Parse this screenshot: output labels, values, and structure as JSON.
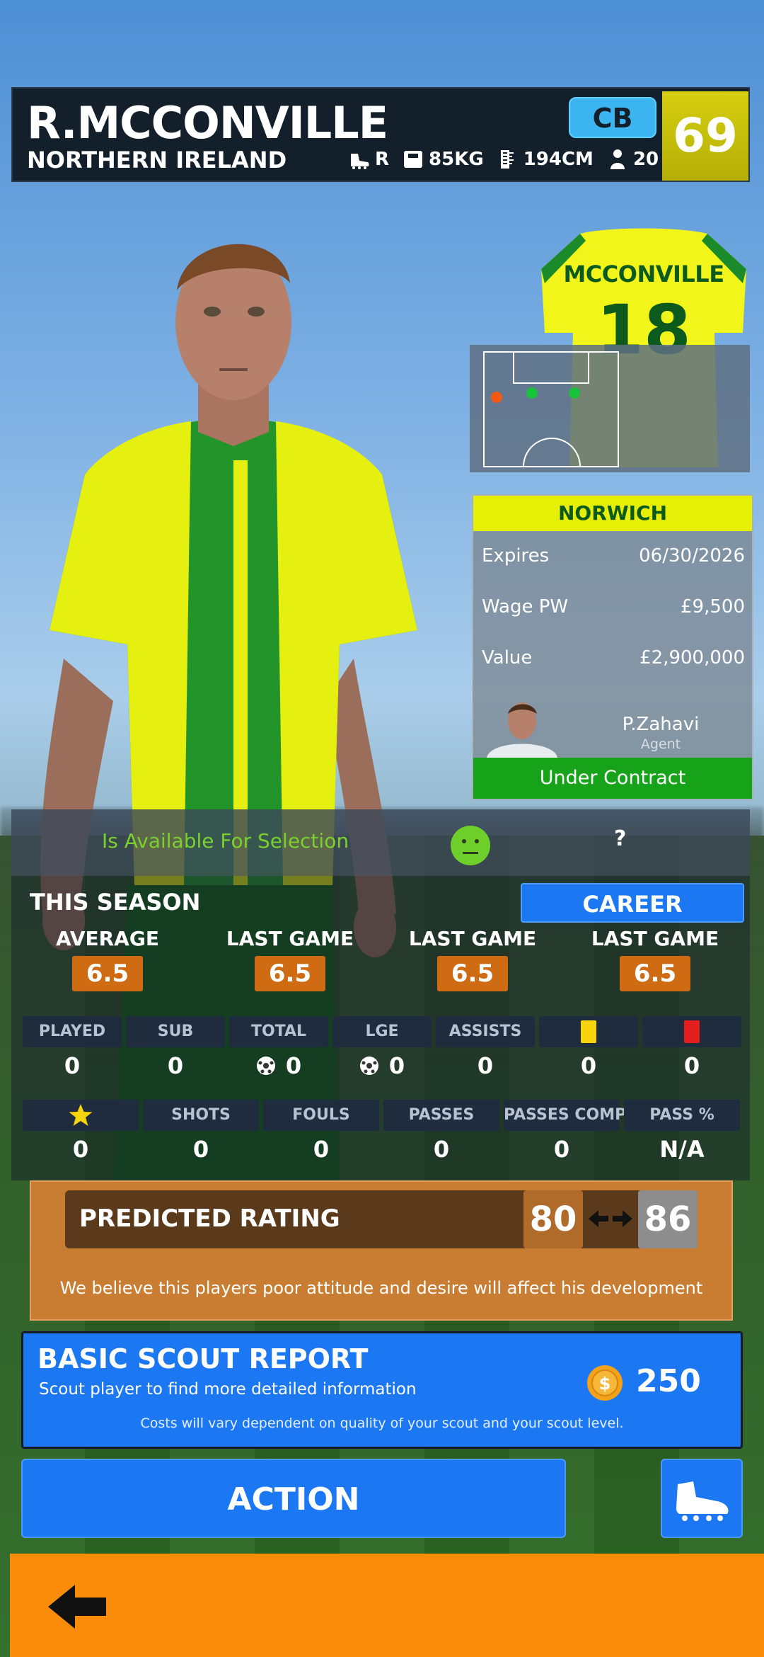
{
  "header": {
    "player_name": "R.MCCONVILLE",
    "nationality": "NORTHERN IRELAND",
    "position": "CB",
    "overall": "69",
    "foot": "R",
    "weight": "85KG",
    "height": "194CM",
    "age": "20"
  },
  "shirt": {
    "name": "MCCONVILLE",
    "number": "18"
  },
  "club": {
    "name": "NORWICH",
    "expires_label": "Expires",
    "expires_value": "06/30/2026",
    "wage_label": "Wage PW",
    "wage_value": "£9,500",
    "value_label": "Value",
    "value_value": "£2,900,000",
    "agent_name": "P.Zahavi",
    "agent_role": "Agent",
    "contract_status": "Under Contract"
  },
  "availability": {
    "text": "Is Available For Selection",
    "unknown": "?"
  },
  "season": {
    "title": "THIS SEASON",
    "career_button": "CAREER",
    "ratings": [
      {
        "label": "AVERAGE",
        "value": "6.5"
      },
      {
        "label": "LAST GAME",
        "value": "6.5"
      },
      {
        "label": "LAST GAME",
        "value": "6.5"
      },
      {
        "label": "LAST GAME",
        "value": "6.5"
      }
    ],
    "stats_row1": [
      {
        "label": "PLAYED",
        "value": "0"
      },
      {
        "label": "SUB",
        "value": "0"
      },
      {
        "label": "TOTAL",
        "value": "0"
      },
      {
        "label": "LGE",
        "value": "0"
      },
      {
        "label": "ASSISTS",
        "value": "0"
      },
      {
        "label": "",
        "value": "0"
      },
      {
        "label": "",
        "value": "0"
      }
    ],
    "stats_row2": [
      {
        "label": "",
        "value": "0"
      },
      {
        "label": "SHOTS",
        "value": "0"
      },
      {
        "label": "FOULS",
        "value": "0"
      },
      {
        "label": "PASSES",
        "value": "0"
      },
      {
        "label": "PASSES COMP",
        "value": "0"
      },
      {
        "label": "PASS %",
        "value": "N/A"
      }
    ]
  },
  "predicted": {
    "title": "PREDICTED RATING",
    "low": "80",
    "high": "86",
    "note": "We believe this players poor attitude and desire will affect his development"
  },
  "scout": {
    "title": "BASIC SCOUT REPORT",
    "subtitle": "Scout player to find more detailed information",
    "cost": "250",
    "note": "Costs will vary dependent on quality of your scout and your scout level."
  },
  "actions": {
    "action_label": "ACTION"
  },
  "colors": {
    "ovr_badge": "#c8c10a",
    "position_badge": "#3cb4f0",
    "club_strip": "#e6ef06",
    "contract_green": "#16a31a",
    "rating_orange": "#cf6b12",
    "primary_blue": "#1b78f2",
    "bottom_orange": "#fb8c0a"
  },
  "icons": [
    "boot-icon",
    "weight-icon",
    "height-icon",
    "person-icon",
    "ball-icon",
    "star-icon",
    "yellow-card-icon",
    "red-card-icon",
    "coin-icon",
    "neutral-face-icon",
    "back-arrow-icon",
    "swap-arrows-icon"
  ]
}
